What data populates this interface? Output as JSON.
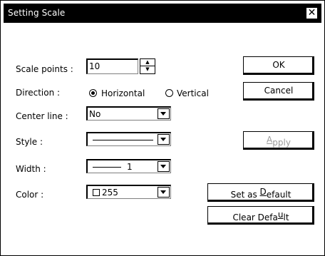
{
  "dialog": {
    "title": "Setting Scale",
    "close_glyph": "✕"
  },
  "fields": {
    "scale_points": {
      "label": "Scale points :",
      "value": "10"
    },
    "direction": {
      "label": "Direction :",
      "options": [
        "Horizontal",
        "Vertical"
      ],
      "selected": "Horizontal"
    },
    "center_line": {
      "label": "Center line :",
      "value": "No"
    },
    "style": {
      "label": "Style :",
      "value": "solid-line"
    },
    "width": {
      "label": "Width :",
      "value": "1"
    },
    "color": {
      "label": "Color :",
      "value": "255"
    }
  },
  "buttons": {
    "ok": "OK",
    "cancel": "Cancel",
    "apply_pre": "",
    "apply_acc": "A",
    "apply_post": "pply",
    "set_default_pre": "Set as ",
    "set_default_acc": "D",
    "set_default_post": "efault",
    "clear_default_pre": "Clear Defa",
    "clear_default_acc": "u",
    "clear_default_post": "lt"
  },
  "icons": {
    "spin_up": "▲",
    "spin_down": "▼",
    "dropdown": "chevron-down-icon",
    "close": "close-icon",
    "radio": "radio-icon"
  }
}
